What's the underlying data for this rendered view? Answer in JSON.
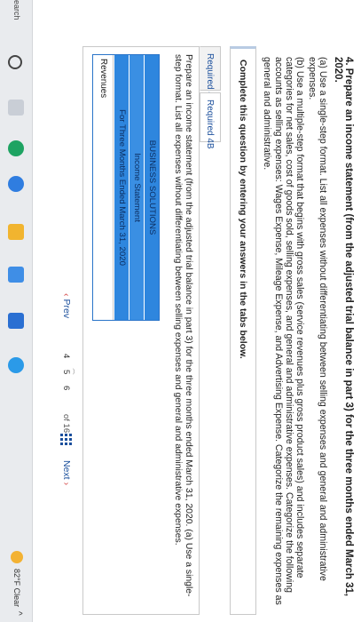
{
  "problem": {
    "title": "4. Prepare an income statement (from the adjusted trial balance in part 3) for the three months ended March 31, 2020.",
    "part_a": "(a) Use a single-step format. List all expenses without differentiating between selling expenses and general and administrative expenses.",
    "part_b": "(b) Use a multiple-step format that begins with gross sales (service revenues plus gross product sales) and includes separate categories for net sales, cost of goods sold, selling expenses, and general and administrative expenses. Categorize the following accounts as selling expenses: Wages Expense, Mileage Expense, and Advertising Expense. Categorize the remaining expenses as general and administrative."
  },
  "instruction": "Complete this question by entering your answers in the tabs below.",
  "tabs": [
    {
      "label": "Required 4A"
    },
    {
      "label": "Required 4B"
    }
  ],
  "panel": {
    "instruction": "Prepare an income statement (from the adjusted trial balance in part 3) for the three months ended March 31, 2020. (a) Use a single-step format. List all expenses without differentiating between selling expenses and general and administrative expenses."
  },
  "statement": {
    "company": "BUSINESS SOLUTIONS",
    "name": "Income Statement",
    "period": "For Three Months Ended March 31, 2020",
    "first_row": "Revenues"
  },
  "pager": {
    "prev_label": "Prev",
    "pages": [
      "4",
      "5",
      "6"
    ],
    "current": "5",
    "total": "of 16",
    "next_label": "Next"
  },
  "taskbar": {
    "search_label": "earch",
    "weather": "82°F Clear"
  },
  "colors": {
    "link": "#1b4f9c",
    "accent_red": "#d23a3a",
    "table_blue": "#2e86de"
  }
}
